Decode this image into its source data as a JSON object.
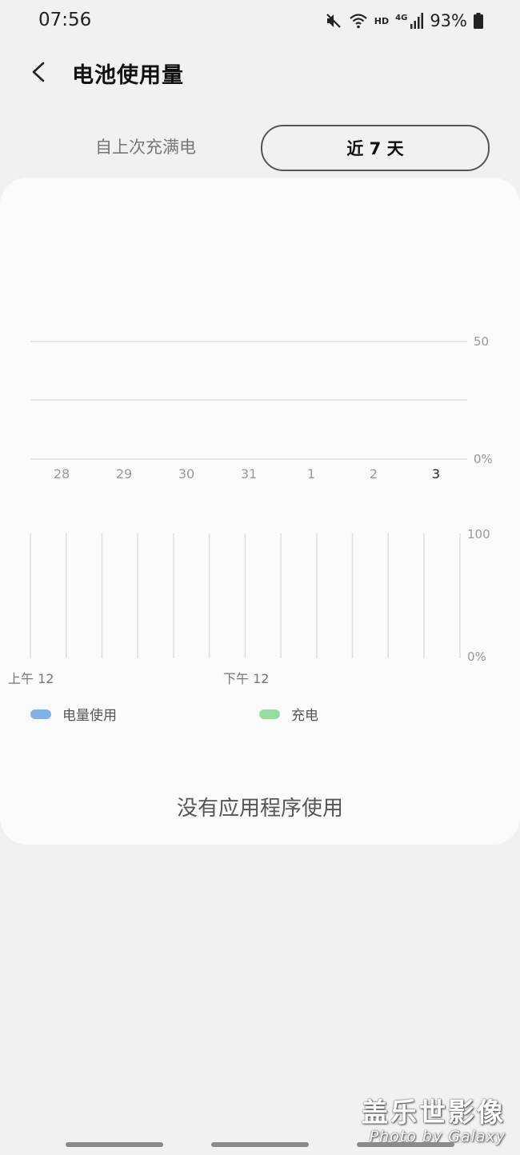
{
  "status_bar": {
    "time": "07:56",
    "hd_label": "HD",
    "network_label": "4G",
    "battery_percent": "93%",
    "icons": [
      "mute-icon",
      "wifi-icon",
      "signal-icon",
      "battery-icon"
    ]
  },
  "header": {
    "title": "电池使用量",
    "back_icon": "back-chevron-icon"
  },
  "tabs": [
    {
      "label": "自上次充满电",
      "selected": false
    },
    {
      "label": "近 7 天",
      "selected": true
    }
  ],
  "daily_chart": {
    "chart_data": {
      "type": "bar",
      "categories": [
        "28",
        "29",
        "30",
        "31",
        "1",
        "2",
        "3"
      ],
      "values": [
        0,
        0,
        0,
        0,
        0,
        0,
        0
      ],
      "y_tick_labels": [
        "50",
        "0%"
      ],
      "ylim": [
        0,
        100
      ],
      "highlighted_category": "3",
      "grid": true
    }
  },
  "hourly_chart": {
    "chart_data": {
      "type": "line",
      "y_tick_labels": [
        "100",
        "0%"
      ],
      "x_tick_labels": [
        "上午 12",
        "下午 12"
      ],
      "ylim": [
        0,
        100
      ],
      "grid": true,
      "values": []
    }
  },
  "legend": [
    {
      "label": "电量使用",
      "color": "#7fb2e8"
    },
    {
      "label": "充电",
      "color": "#93dfa1"
    }
  ],
  "empty_state": "没有应用程序使用",
  "watermark": {
    "main": "盖乐世影像",
    "sub": "Photo by Galaxy"
  },
  "colors": {
    "background": "#f1f1f1",
    "card": "#fbfbfb",
    "grid": "#dedede",
    "axis_text": "#999999"
  }
}
